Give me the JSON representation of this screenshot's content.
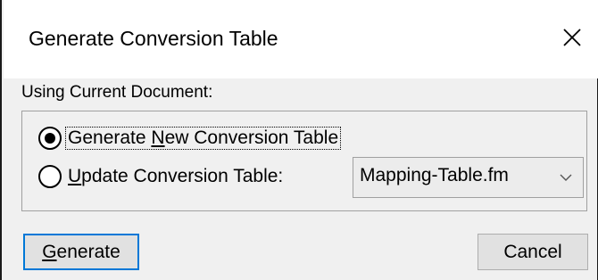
{
  "dialog": {
    "title": "Generate Conversion Table",
    "close_icon": "close-icon"
  },
  "section": {
    "label": "Using Current Document:"
  },
  "options": {
    "generate_new": {
      "prefix": "Generate ",
      "mnemonic": "N",
      "suffix": "ew Conversion Table",
      "selected": true
    },
    "update": {
      "mnemonic": "U",
      "suffix": "pdate Conversion Table:",
      "selected": false
    }
  },
  "table_select": {
    "value": "Mapping-Table.fm",
    "chevron_icon": "chevron-down-icon"
  },
  "buttons": {
    "generate": {
      "mnemonic": "G",
      "suffix": "enerate"
    },
    "cancel": {
      "label": "Cancel"
    }
  }
}
